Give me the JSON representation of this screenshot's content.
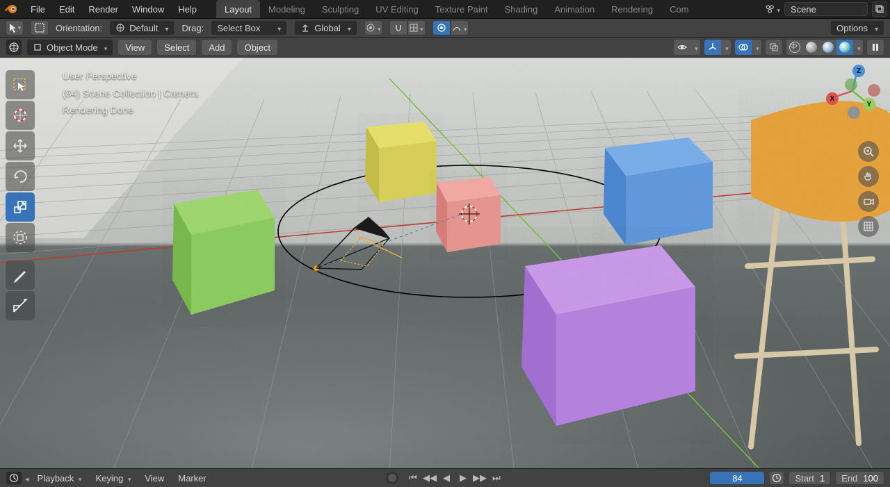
{
  "topbar": {
    "menus": [
      "File",
      "Edit",
      "Render",
      "Window",
      "Help"
    ],
    "workspaces": [
      "Layout",
      "Modeling",
      "Sculpting",
      "UV Editing",
      "Texture Paint",
      "Shading",
      "Animation",
      "Rendering",
      "Com"
    ],
    "active_workspace": 0,
    "scene_name": "Scene"
  },
  "toolbar2": {
    "orientation_label": "Orientation:",
    "orientation_value": "Default",
    "drag_label": "Drag:",
    "drag_value": "Select Box",
    "transform_value": "Global",
    "options_label": "Options"
  },
  "editor_header": {
    "mode": "Object Mode",
    "menus": [
      "View",
      "Select",
      "Add",
      "Object"
    ]
  },
  "overlay": {
    "line1": "User Perspective",
    "line2": "(84) Scene Collection | Camera",
    "line3": "Rendering Done"
  },
  "gizmo": {
    "x": "X",
    "y": "Y",
    "z": "Z"
  },
  "timeline": {
    "playback": "Playback",
    "keying": "Keying",
    "view": "View",
    "marker": "Marker",
    "current": "84",
    "start_label": "Start",
    "start_value": "1",
    "end_label": "End",
    "end_value": "100"
  },
  "tools": [
    "select-box",
    "cursor",
    "move",
    "rotate",
    "scale",
    "transform",
    "annotate",
    "measure"
  ]
}
